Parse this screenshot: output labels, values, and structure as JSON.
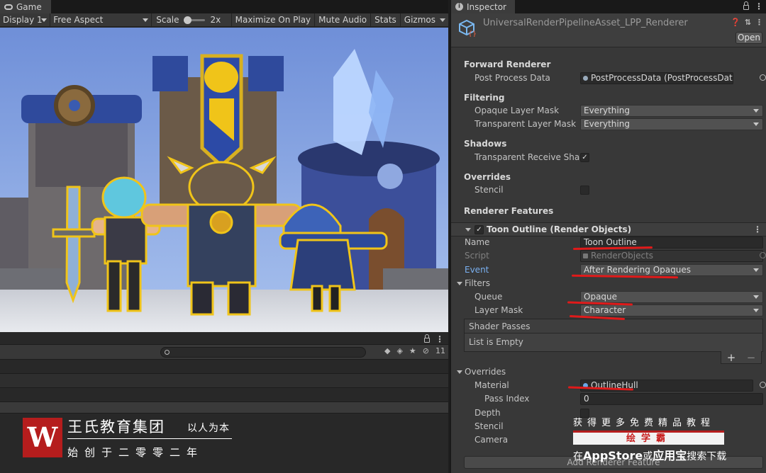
{
  "game": {
    "tab_label": "Game",
    "toolbar": {
      "display": "Display 1",
      "aspect": "Free Aspect",
      "scale_label": "Scale",
      "scale_value": "2x",
      "maximize": "Maximize On Play",
      "mute": "Mute Audio",
      "stats": "Stats",
      "gizmos": "Gizmos"
    }
  },
  "console": {
    "count": "11"
  },
  "watermark_left": {
    "logo_letter": "W",
    "org": "王氏教育集团",
    "motto": "以人为本",
    "founded": "始创于二零零二年"
  },
  "inspector": {
    "tab_label": "Inspector",
    "asset_title": "UniversalRenderPipelineAsset_LPP_Renderer",
    "open_button": "Open",
    "forward_renderer": {
      "header": "Forward Renderer",
      "post_process_label": "Post Process Data",
      "post_process_value": "PostProcessData (PostProcessData)"
    },
    "filtering": {
      "header": "Filtering",
      "opaque_label": "Opaque Layer Mask",
      "opaque_value": "Everything",
      "transparent_label": "Transparent Layer Mask",
      "transparent_value": "Everything"
    },
    "shadows": {
      "header": "Shadows",
      "receive_label": "Transparent Receive Shadows",
      "receive_checked": true
    },
    "overrides": {
      "header": "Overrides",
      "stencil_label": "Stencil"
    },
    "renderer_features_header": "Renderer Features",
    "feature": {
      "title": "Toon Outline (Render Objects)",
      "name_label": "Name",
      "name_value": "Toon Outline",
      "script_label": "Script",
      "script_value": "RenderObjects",
      "event_label": "Event",
      "event_value": "After Rendering Opaques",
      "filters_header": "Filters",
      "queue_label": "Queue",
      "queue_value": "Opaque",
      "layer_mask_label": "Layer Mask",
      "layer_mask_value": "Character",
      "shader_passes_label": "Shader Passes",
      "list_empty": "List is Empty",
      "plus": "+",
      "minus": "−",
      "overrides_header": "Overrides",
      "material_label": "Material",
      "material_value": "OutlineHull",
      "pass_index_label": "Pass Index",
      "pass_index_value": "0",
      "depth_label": "Depth",
      "stencil_label": "Stencil",
      "camera_label": "Camera"
    },
    "add_feature_button": "Add Renderer Feature"
  },
  "watermark_right": {
    "line1": "获得更多免费精品教程",
    "band": "绘学霸",
    "line2_prefix": "在",
    "line2_store": "AppStore",
    "line2_mid": "或",
    "line2_app": "应用宝",
    "line2_suffix": "搜索下载"
  },
  "colors": {
    "editor_bg": "#383838",
    "accent_blue": "#7ab0f0",
    "annotation_red": "#e01a1a",
    "outline_yellow": "#f0c419"
  }
}
